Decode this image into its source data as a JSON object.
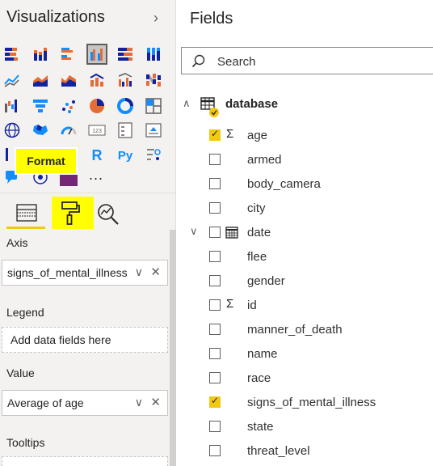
{
  "visualizations": {
    "title": "Visualizations",
    "collapse_icon": "chevron-right-icon",
    "more_label": "...",
    "tooltip": "Format",
    "tabs": [
      {
        "name": "fields-tab",
        "icon": "fields-icon"
      },
      {
        "name": "format-tab",
        "icon": "paint-roller-icon"
      },
      {
        "name": "analytics-tab",
        "icon": "analytics-icon"
      }
    ],
    "sections": {
      "axis_label": "Axis",
      "axis_value": "signs_of_mental_illness",
      "legend_label": "Legend",
      "legend_placeholder": "Add data fields here",
      "value_label": "Value",
      "value_value": "Average of age",
      "tooltips_label": "Tooltips"
    }
  },
  "fields": {
    "title": "Fields",
    "search_placeholder": "Search",
    "table_name": "database",
    "items": [
      {
        "label": "age",
        "checked": true,
        "type": "sigma"
      },
      {
        "label": "armed",
        "checked": false,
        "type": ""
      },
      {
        "label": "body_camera",
        "checked": false,
        "type": ""
      },
      {
        "label": "city",
        "checked": false,
        "type": ""
      },
      {
        "label": "date",
        "checked": false,
        "type": "calendar"
      },
      {
        "label": "flee",
        "checked": false,
        "type": ""
      },
      {
        "label": "gender",
        "checked": false,
        "type": ""
      },
      {
        "label": "id",
        "checked": false,
        "type": "sigma"
      },
      {
        "label": "manner_of_death",
        "checked": false,
        "type": ""
      },
      {
        "label": "name",
        "checked": false,
        "type": ""
      },
      {
        "label": "race",
        "checked": false,
        "type": ""
      },
      {
        "label": "signs_of_mental_illness",
        "checked": true,
        "type": ""
      },
      {
        "label": "state",
        "checked": false,
        "type": ""
      },
      {
        "label": "threat_level",
        "checked": false,
        "type": ""
      }
    ]
  },
  "colors": {
    "accent": "#f2c811",
    "highlight": "#ffff00",
    "chart_blue": "#118dff",
    "chart_orange": "#e66c37",
    "chart_dark": "#12239e"
  }
}
